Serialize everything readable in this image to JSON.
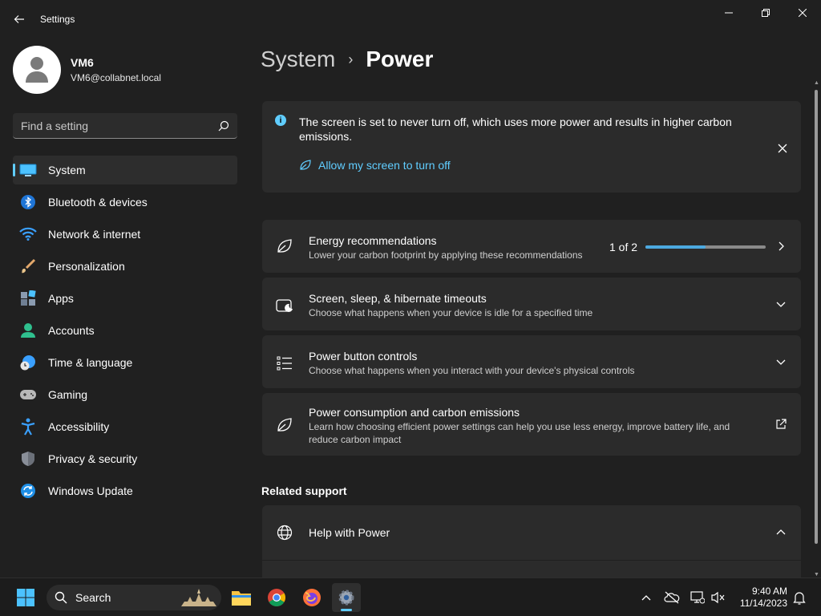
{
  "window": {
    "title": "Settings"
  },
  "profile": {
    "name": "VM6",
    "email": "VM6@collabnet.local"
  },
  "search": {
    "placeholder": "Find a setting"
  },
  "nav": {
    "items": [
      {
        "label": "System",
        "icon": "system-icon",
        "active": true
      },
      {
        "label": "Bluetooth & devices",
        "icon": "bluetooth-icon"
      },
      {
        "label": "Network & internet",
        "icon": "wifi-icon"
      },
      {
        "label": "Personalization",
        "icon": "brush-icon"
      },
      {
        "label": "Apps",
        "icon": "apps-icon"
      },
      {
        "label": "Accounts",
        "icon": "account-icon"
      },
      {
        "label": "Time & language",
        "icon": "globe-clock-icon"
      },
      {
        "label": "Gaming",
        "icon": "gamepad-icon"
      },
      {
        "label": "Accessibility",
        "icon": "accessibility-icon"
      },
      {
        "label": "Privacy & security",
        "icon": "shield-icon"
      },
      {
        "label": "Windows Update",
        "icon": "update-icon"
      }
    ]
  },
  "breadcrumb": {
    "parent": "System",
    "separator": "›",
    "current": "Power"
  },
  "info_bar": {
    "message": "The screen is set to never turn off, which uses more power and results in higher carbon emissions.",
    "link": "Allow my screen to turn off"
  },
  "cards": [
    {
      "title": "Energy recommendations",
      "desc": "Lower your carbon footprint by applying these recommendations",
      "icon": "leaf-icon",
      "right": "chevron-right-icon",
      "progress_label": "1 of 2",
      "progress": 0.5
    },
    {
      "title": "Screen, sleep, & hibernate timeouts",
      "desc": "Choose what happens when your device is idle for a specified time",
      "icon": "sleep-icon",
      "right": "chevron-down-icon"
    },
    {
      "title": "Power button controls",
      "desc": "Choose what happens when you interact with your device's physical controls",
      "icon": "list-icon",
      "right": "chevron-down-icon"
    },
    {
      "title": "Power consumption and carbon emissions",
      "desc": "Learn how choosing efficient power settings can help you use less energy, improve battery life, and reduce carbon impact",
      "icon": "leaf-icon",
      "right": "external-link-icon"
    }
  ],
  "related": {
    "heading": "Related support",
    "help_title": "Help with Power"
  },
  "taskbar": {
    "search_label": "Search",
    "time": "9:40 AM",
    "date": "11/14/2023"
  },
  "colors": {
    "accent": "#60cdff",
    "background": "#202020",
    "card": "#2b2b2b"
  }
}
